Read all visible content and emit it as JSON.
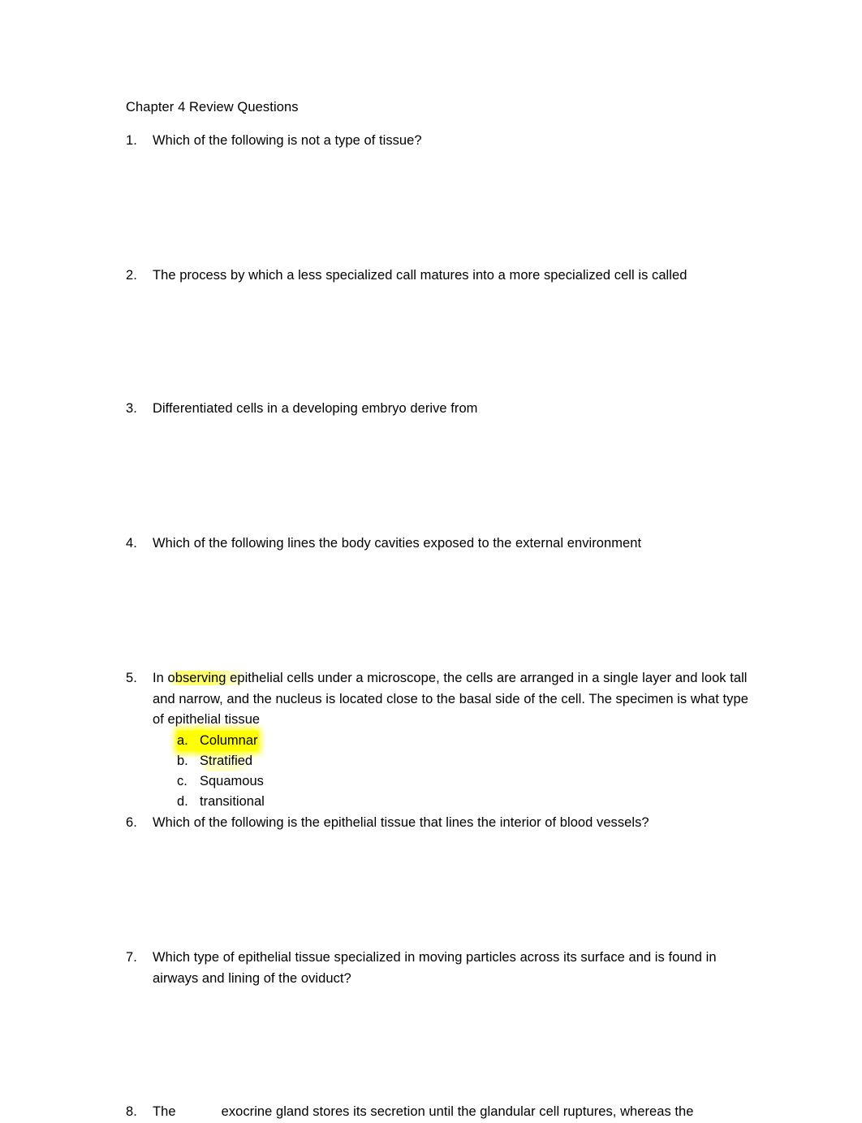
{
  "document": {
    "title": "Chapter 4 Review Questions",
    "background_color": "#ffffff",
    "text_color": "#000000",
    "highlight_color": "#ffff00"
  },
  "questions": [
    {
      "number": "1.",
      "text": "Which of the following is not a type of tissue?"
    },
    {
      "number": "2.",
      "text": "The process by which a less specialized call matures into a more specialized cell is called"
    },
    {
      "number": "3.",
      "text": "Differentiated cells in a developing embryo derive from"
    },
    {
      "number": "4.",
      "text": "Which of the following lines the body cavities exposed to the external environment"
    },
    {
      "number": "5.",
      "text_part_1": "In ",
      "text_highlighted": "observing epi",
      "text_part_2": "thelial cells under a microscope, the cells are arranged in a single layer and look tall and narrow, and the nucleus is located close to the basal side of the cell. The specimen is what type of epithelial tissue",
      "options": [
        {
          "letter": "a.",
          "label": "Columnar",
          "highlight": "strong"
        },
        {
          "letter": "b.",
          "label": "Stratified",
          "highlight": "faint"
        },
        {
          "letter": "c.",
          "label": "Squamous",
          "highlight": "none"
        },
        {
          "letter": "d.",
          "label": "transitional",
          "highlight": "none"
        }
      ]
    },
    {
      "number": "6.",
      "text": "Which of the following is the epithelial tissue that lines the interior of blood vessels?"
    },
    {
      "number": "7.",
      "text": "Which type of epithelial tissue specialized in moving particles across its surface and is found in airways and lining of the oviduct?"
    },
    {
      "number": "8.",
      "text_before_blank": "The",
      "text_after_blank": "exocrine gland stores its secretion until the glandular cell ruptures, whereas the"
    }
  ]
}
